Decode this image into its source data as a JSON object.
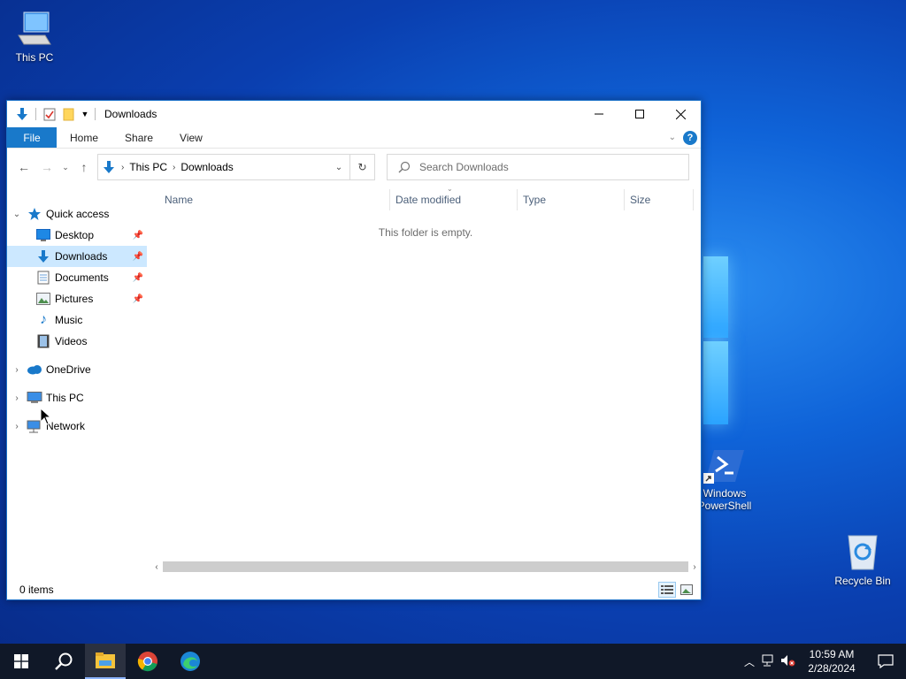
{
  "desktop": {
    "icons": {
      "this_pc": "This PC",
      "powershell_line1": "Windows",
      "powershell_line2": "PowerShell",
      "recycle_bin": "Recycle Bin"
    }
  },
  "window": {
    "title": "Downloads",
    "ribbon": {
      "file": "File",
      "tabs": [
        "Home",
        "Share",
        "View"
      ],
      "help": "?"
    },
    "address": {
      "crumbs": [
        "This PC",
        "Downloads"
      ]
    },
    "search": {
      "placeholder": "Search Downloads"
    },
    "nav_pane": {
      "quick_access": "Quick access",
      "quick_items": [
        "Desktop",
        "Downloads",
        "Documents",
        "Pictures",
        "Music",
        "Videos"
      ],
      "onedrive": "OneDrive",
      "this_pc": "This PC",
      "network": "Network"
    },
    "columns": [
      "Name",
      "Date modified",
      "Type",
      "Size"
    ],
    "empty_message": "This folder is empty.",
    "status": {
      "item_count": "0 items"
    }
  },
  "taskbar": {
    "clock": {
      "time": "10:59 AM",
      "date": "2/28/2024"
    }
  },
  "colors": {
    "accent": "#1979ca",
    "selection": "#cce8ff",
    "taskbar": "#101828"
  },
  "icons": [
    "this-pc-icon",
    "powershell-icon",
    "recycle-bin-icon",
    "download-arrow-icon",
    "properties-icon",
    "new-folder-icon",
    "help-icon",
    "search-icon",
    "refresh-icon",
    "star-icon",
    "onedrive-icon",
    "network-icon",
    "windows-start-icon",
    "chrome-icon",
    "edge-icon",
    "file-explorer-icon"
  ]
}
